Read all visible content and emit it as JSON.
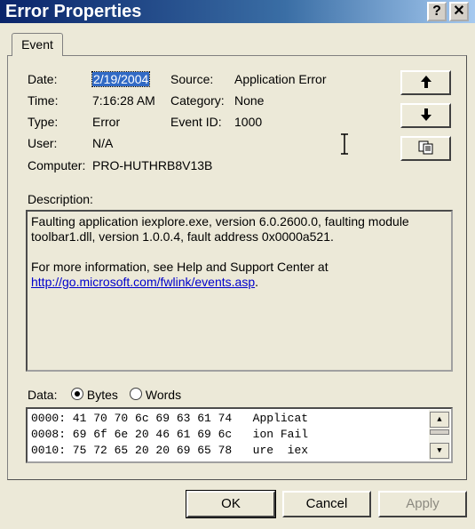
{
  "window": {
    "title": "Error Properties",
    "help_glyph": "?",
    "close_glyph": "✕"
  },
  "tabs": [
    {
      "label": "Event"
    }
  ],
  "event": {
    "date_label": "Date:",
    "date_value": "2/19/2004",
    "source_label": "Source:",
    "source_value": "Application Error",
    "time_label": "Time:",
    "time_value": "7:16:28 AM",
    "category_label": "Category:",
    "category_value": "None",
    "type_label": "Type:",
    "type_value": "Error",
    "eventid_label": "Event ID:",
    "eventid_value": "1000",
    "user_label": "User:",
    "user_value": "N/A",
    "computer_label": "Computer:",
    "computer_value": "PRO-HUTHRB8V13B"
  },
  "description": {
    "label": "Description:",
    "line1": "Faulting application iexplore.exe, version 6.0.2600.0, faulting module toolbar1.dll, version 1.0.0.4, fault address 0x0000a521.",
    "line2": "For more information, see Help and Support Center at",
    "link": "http://go.microsoft.com/fwlink/events.asp",
    "link_suffix": "."
  },
  "data_section": {
    "label": "Data:",
    "bytes_label": "Bytes",
    "words_label": "Words",
    "selected": "Bytes",
    "rows": [
      "0000: 41 70 70 6c 69 63 61 74   Applicat",
      "0008: 69 6f 6e 20 46 61 69 6c   ion Fail",
      "0010: 75 72 65 20 20 69 65 78   ure  iex"
    ]
  },
  "buttons": {
    "ok": "OK",
    "cancel": "Cancel",
    "apply": "Apply"
  },
  "icons": [
    "up-arrow-icon",
    "down-arrow-icon",
    "copy-icon",
    "text-cursor-icon"
  ]
}
